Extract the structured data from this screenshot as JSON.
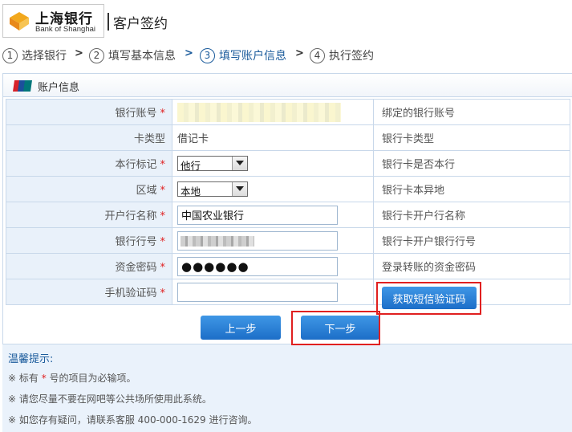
{
  "header": {
    "logo_cn": "上海银行",
    "logo_en": "Bank of Shanghai",
    "title": "客户签约"
  },
  "steps": [
    {
      "num": "1",
      "label": "选择银行",
      "active": false
    },
    {
      "num": "2",
      "label": "填写基本信息",
      "active": false
    },
    {
      "num": "3",
      "label": "填写账户信息",
      "active": true
    },
    {
      "num": "4",
      "label": "执行签约",
      "active": false
    }
  ],
  "panel": {
    "title": "账户信息",
    "icon": "unionpay-icon"
  },
  "form": {
    "rows": [
      {
        "label": "银行账号",
        "required": true,
        "value": "",
        "desc": "绑定的银行账号"
      },
      {
        "label": "卡类型",
        "required": false,
        "value": "借记卡",
        "desc": "银行卡类型"
      },
      {
        "label": "本行标记",
        "required": true,
        "value": "他行",
        "desc": "银行卡是否本行"
      },
      {
        "label": "区域",
        "required": true,
        "value": "本地",
        "desc": "银行卡本异地"
      },
      {
        "label": "开户行名称",
        "required": true,
        "value": "中国农业银行",
        "desc": "银行卡开户行名称"
      },
      {
        "label": "银行行号",
        "required": true,
        "value": "",
        "desc": "银行卡开户银行行号"
      },
      {
        "label": "资金密码",
        "required": true,
        "value": "●●●●●●",
        "desc": "登录转账的资金密码"
      },
      {
        "label": "手机验证码",
        "required": true,
        "value": "",
        "desc": ""
      }
    ],
    "required_mark": "*",
    "sms_button": "获取短信验证码"
  },
  "actions": {
    "prev": "上一步",
    "next": "下一步"
  },
  "tips": {
    "title": "温馨提示:",
    "items": [
      {
        "prefix": "※ 标有 ",
        "star": "*",
        "suffix": " 号的项目为必输项。"
      },
      {
        "text": "※ 请您尽量不要在网吧等公共场所使用此系统。"
      },
      {
        "text": "※ 如您存有疑问，请联系客服 400-000-1629 进行咨询。"
      }
    ]
  },
  "colors": {
    "accent": "#1c5c9c",
    "button": "#2a80d6",
    "label_bg": "#e9f1fa",
    "required": "#e02020",
    "highlight": "#e02020"
  }
}
